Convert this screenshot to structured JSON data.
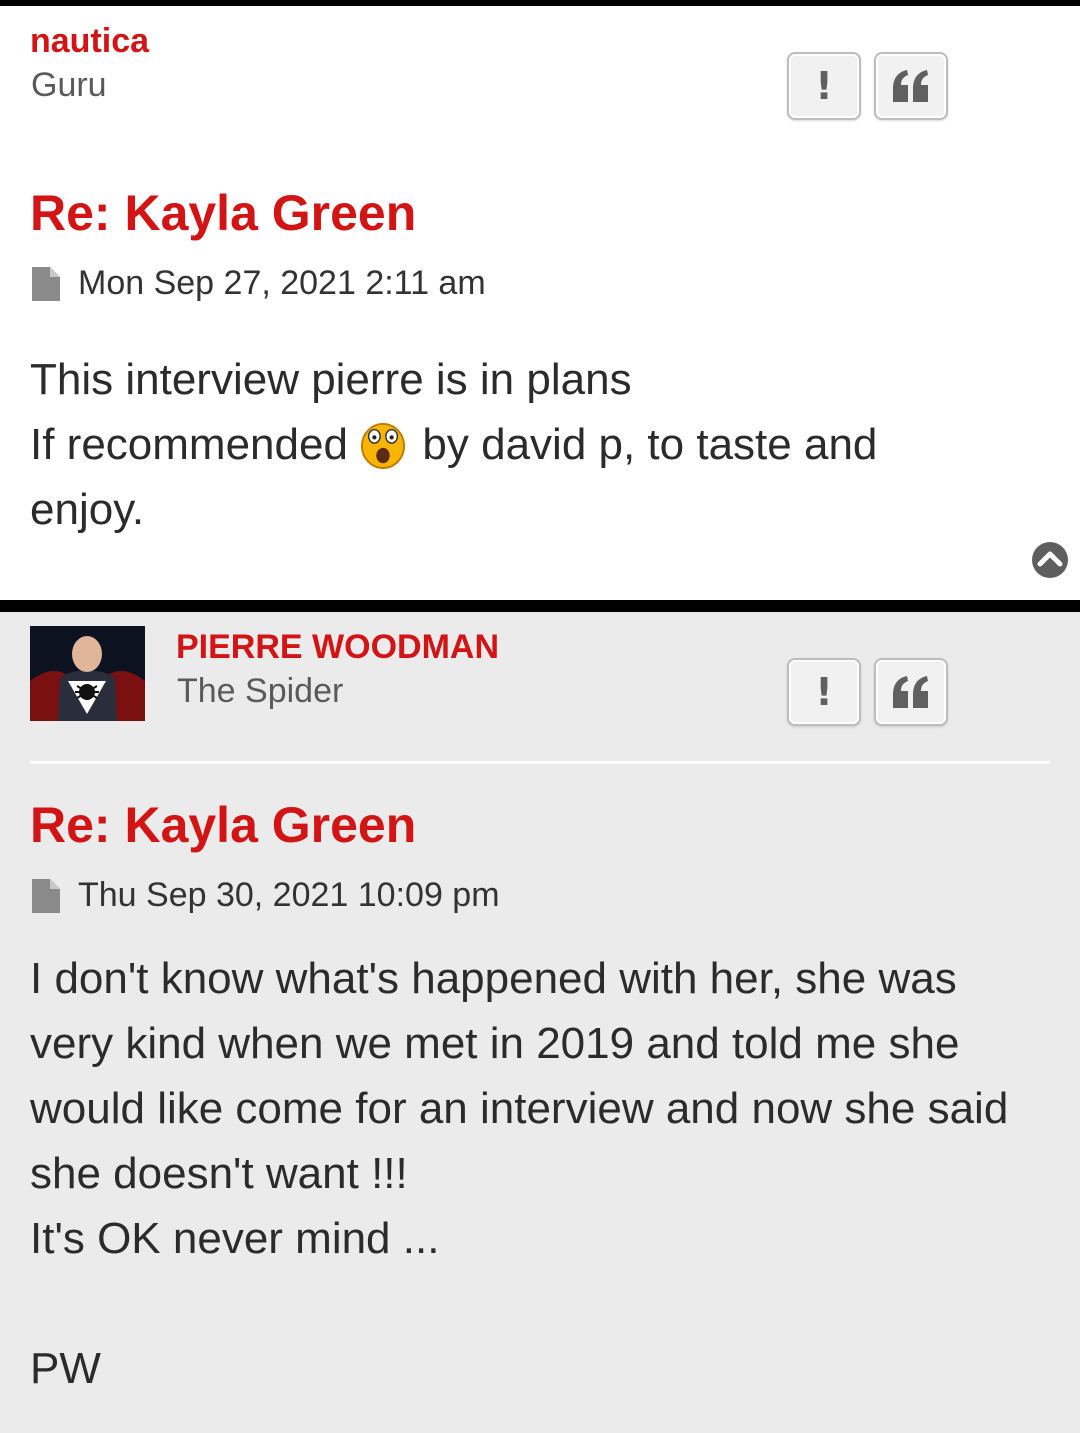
{
  "posts": [
    {
      "author": "nautica",
      "rank": "Guru",
      "title": "Re: Kayla Green",
      "date": "Mon Sep 27, 2021 2:11 am",
      "lines": {
        "l1": "This interview pierre is in plans",
        "l2a": "If recommended",
        "l2b": "by david p, to taste and",
        "l3": "enjoy."
      },
      "emoji": "astonished-face-emoji"
    },
    {
      "author": "PIERRE WOODMAN",
      "rank": "The Spider",
      "title": "Re: Kayla Green",
      "date": "Thu Sep 30, 2021 10:09 pm",
      "paragraphs": {
        "p1": "I don't know what's happened with her, she was very kind when we met in 2019 and told me she would like come for an interview and now she said she doesn't want !!!",
        "p2": "It's OK never mind ...",
        "p3": "PW"
      }
    }
  ],
  "buttons": {
    "report": "!"
  },
  "icons": {
    "report": "exclamation-icon",
    "quote": "quote-icon",
    "post": "document-icon",
    "top": "back-to-top-icon"
  },
  "colors": {
    "accent": "#d31414",
    "rank": "#5a5a5a",
    "text": "#2b2b2b",
    "post_bg_alt": "#ebebeb",
    "separator": "#000000"
  }
}
